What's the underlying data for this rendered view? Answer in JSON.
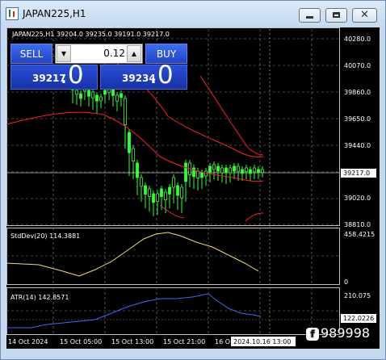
{
  "window": {
    "title": "JAPAN225,H1",
    "controls": {
      "minimize_icon": "minimize-icon",
      "maximize_icon": "maximize-icon",
      "close_icon": "close-icon",
      "close_glyph": "✕"
    }
  },
  "chart": {
    "header": "JAPAN225,H1  39204.0 39235.0 39191.0 39217.0",
    "price_axis_labels": [
      "40280.0",
      "40070.0",
      "39860.0",
      "39650.0",
      "39440.0",
      "39217.0",
      "39020.0",
      "38810.0"
    ],
    "current_price_label": "39217.0",
    "stddev_label": "StdDev(20) 114.3881",
    "stddev_axis": [
      "458.4215",
      "0"
    ],
    "atr_label": "ATR(14) 142.8571",
    "atr_axis": [
      "210.075",
      "122.0226"
    ],
    "time_labels": [
      "14 Oct 2024",
      "15 Oct 05:00",
      "15 Oct 13:00",
      "15 Oct 21:00",
      "16 O"
    ],
    "crosshair_time": "2024.10.16 13:00"
  },
  "trade_panel": {
    "sell_label": "SELL",
    "buy_label": "BUY",
    "lot_value": "0.12",
    "lot_down_glyph": "▼",
    "lot_up_glyph": "▲",
    "bid_small": "39217",
    "bid_big": ".0",
    "ask_small": "39234",
    "ask_big": ".0"
  },
  "watermark": {
    "icon_glyph": "f",
    "text": "989998"
  },
  "colors": {
    "background": "#000000",
    "grid": "#8a8a8a",
    "bull_candle": "#33ff33",
    "bear_candle": "#33ff33",
    "envelope": "#ff2020",
    "stddev_line": "#f0e060",
    "atr_line": "#3a6cff",
    "axis_text": "#ffffff"
  }
}
